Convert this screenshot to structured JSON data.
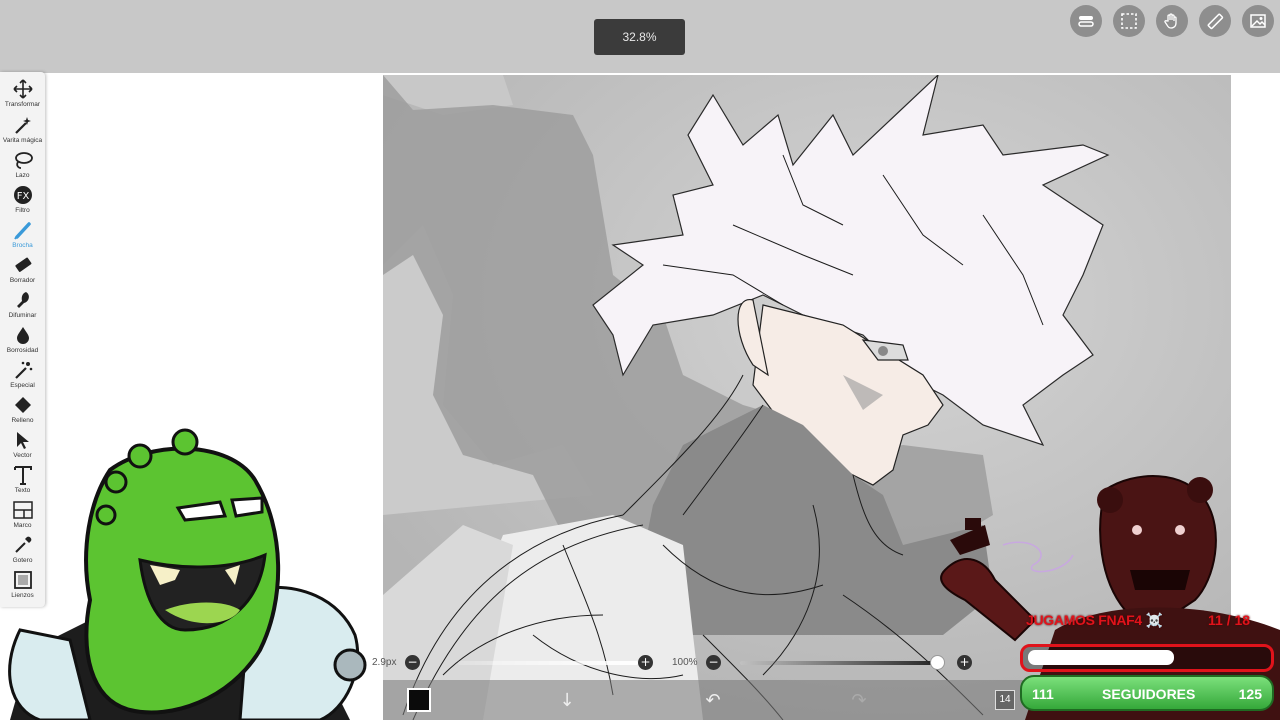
{
  "app": {
    "zoom": "32.8%"
  },
  "top_icons": [
    {
      "name": "layer-toggle-icon"
    },
    {
      "name": "selection-icon"
    },
    {
      "name": "hand-icon"
    },
    {
      "name": "ruler-icon"
    },
    {
      "name": "image-icon"
    }
  ],
  "tools": [
    {
      "label": "Transformar",
      "icon": "move-icon"
    },
    {
      "label": "Varita mágica",
      "icon": "magic-wand-icon"
    },
    {
      "label": "Lazo",
      "icon": "lasso-icon"
    },
    {
      "label": "Filtro",
      "icon": "fx-icon"
    },
    {
      "label": "Brocha",
      "icon": "brush-icon"
    },
    {
      "label": "Borrador",
      "icon": "eraser-icon"
    },
    {
      "label": "Difuminar",
      "icon": "blur-icon"
    },
    {
      "label": "Borrosidad",
      "icon": "drop-icon"
    },
    {
      "label": "Especial",
      "icon": "special-icon"
    },
    {
      "label": "Relleno",
      "icon": "fill-icon"
    },
    {
      "label": "Vector",
      "icon": "vector-icon"
    },
    {
      "label": "Texto",
      "icon": "text-icon"
    },
    {
      "label": "Marco",
      "icon": "frame-icon"
    },
    {
      "label": "Gotero",
      "icon": "eyedropper-icon"
    },
    {
      "label": "Lienzos",
      "icon": "canvas-icon"
    }
  ],
  "active_tool": "Brocha",
  "accent_color": "#3a9ad9",
  "brush": {
    "size": "2.9px",
    "opacity": "100%",
    "size_level": 0.92,
    "opacity_level": 0.85
  },
  "bottom_bar": {
    "layer_count": "14",
    "current_color": "#0b0b0b"
  },
  "stream": {
    "title": "JUGAMOS FNAF4 ☠️",
    "goal_progress": "11 / 18",
    "goal_fraction": 0.61,
    "followers_label": "SEGUIDORES",
    "followers_current": "111",
    "followers_target": "125"
  }
}
